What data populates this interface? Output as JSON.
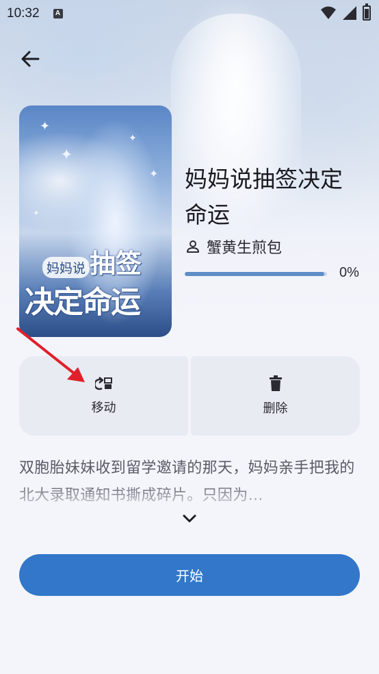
{
  "status_bar": {
    "time": "10:32",
    "notification_icon": "A"
  },
  "book": {
    "title": "妈妈说抽签决定命运",
    "author": "蟹黄生煎包",
    "progress_percent": 0,
    "progress_text": "0%",
    "cover_text_small": "妈妈说",
    "cover_text_big1": "抽签",
    "cover_text_big2": "决定命运"
  },
  "actions": {
    "move_label": "移动",
    "delete_label": "删除"
  },
  "description": "双胞胎妹妹收到留学邀请的那天，妈妈亲手把我的北大录取通知书撕成碎片。只因为…",
  "start_label": "开始",
  "colors": {
    "primary": "#3277c9",
    "progress_fill": "#5f8dc7",
    "action_bg": "#e9ebf3",
    "annotation_arrow": "#e0202a"
  },
  "icons": {
    "back": "arrow-left-icon",
    "author": "person-icon",
    "move": "move-icon",
    "delete": "trash-icon",
    "expand": "chevron-down-icon"
  }
}
